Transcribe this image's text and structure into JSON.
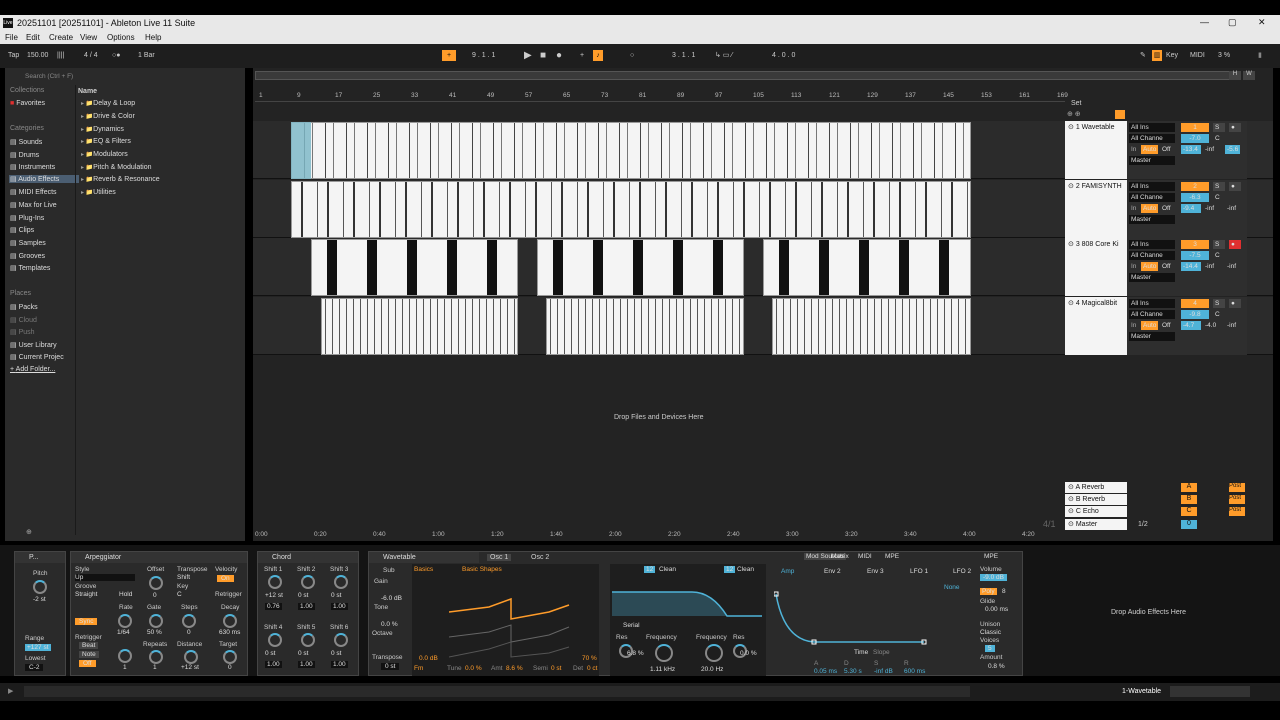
{
  "window": {
    "title": "20251101  [20251101] - Ableton Live 11 Suite",
    "controls": [
      "—",
      "▢",
      "✕"
    ]
  },
  "menu": [
    "File",
    "Edit",
    "Create",
    "View",
    "Options",
    "Help"
  ],
  "transport": {
    "tap": "Tap",
    "tempo": "150.00",
    "signature": "4 / 4",
    "quantize": "1 Bar",
    "position": "9 .  1 .  1",
    "loop_start": "3 .  1 .  1",
    "loop_length": "4 .  0 .  0",
    "key": "Key",
    "midi": "MIDI",
    "cpu": "3 %"
  },
  "browser": {
    "search_placeholder": "Search (Ctrl + F)",
    "collections_label": "Collections",
    "favorites": "Favorites",
    "categories_label": "Categories",
    "categories": [
      "Sounds",
      "Drums",
      "Instruments",
      "Audio Effects",
      "MIDI Effects",
      "Max for Live",
      "Plug-Ins",
      "Clips",
      "Samples",
      "Grooves",
      "Templates"
    ],
    "places_label": "Places",
    "places": [
      "Packs",
      "Cloud",
      "Push",
      "User Library",
      "Current Projec",
      "Add Folder..."
    ],
    "name_header": "Name",
    "folders": [
      "Delay & Loop",
      "Drive & Color",
      "Dynamics",
      "EQ & Filters",
      "Modulators",
      "Pitch & Modulation",
      "Reverb & Resonance",
      "Utilities"
    ]
  },
  "arrangement": {
    "bar_ticks": [
      "1",
      "9",
      "17",
      "25",
      "33",
      "41",
      "49",
      "57",
      "65",
      "73",
      "81",
      "89",
      "97",
      "105",
      "113",
      "121",
      "129",
      "137",
      "145",
      "153",
      "161",
      "169"
    ],
    "time_ticks": [
      "0:00",
      "0:20",
      "0:40",
      "1:00",
      "1:20",
      "1:40",
      "2:00",
      "2:20",
      "2:40",
      "3:00",
      "3:20",
      "3:40",
      "4:00",
      "4:20"
    ],
    "drop_text": "Drop Files and Devices Here",
    "set_label": "Set",
    "page": "4/1",
    "tracks": [
      {
        "name": "1 Wavetable",
        "input": "All Ins",
        "channel": "All Channe",
        "num": "1",
        "vol": "-7.0",
        "pan": "C",
        "meter1": "-13.4",
        "meter2": "-inf",
        "meter3": "-5.6"
      },
      {
        "name": "2 FAMISYNTH",
        "input": "All Ins",
        "channel": "All Channe",
        "num": "2",
        "vol": "-6.3",
        "pan": "C",
        "meter1": "-9.4",
        "meter2": "-inf",
        "meter3": "-inf"
      },
      {
        "name": "3 808 Core Ki",
        "input": "All Ins",
        "channel": "All Channe",
        "num": "3",
        "vol": "-7.5",
        "pan": "C",
        "meter1": "-14.4",
        "meter2": "-inf",
        "meter3": "-inf"
      },
      {
        "name": "4 Magical8bit",
        "input": "All Ins",
        "channel": "All Channe",
        "num": "4",
        "vol": "-9.8",
        "pan": "C",
        "meter1": "-4.7",
        "meter2": "-4.0",
        "meter3": "-inf"
      }
    ],
    "io": {
      "in": "In",
      "auto": "Auto",
      "off": "Off",
      "master": "Master"
    },
    "returns": [
      {
        "name": "A Reverb",
        "letter": "A"
      },
      {
        "name": "B Reverb",
        "letter": "B"
      },
      {
        "name": "C Echo",
        "letter": "C"
      }
    ],
    "master": {
      "name": "Master",
      "ratio": "1/2",
      "vol": "0",
      "post": "Post"
    }
  },
  "devices": {
    "pitch": {
      "title": "P...",
      "label": "Pitch",
      "value": "-2 st",
      "range_label": "Range",
      "range": "+127 st",
      "lowest_label": "Lowest",
      "lowest": "C-2"
    },
    "arp": {
      "title": "Arpeggiator",
      "style_label": "Style",
      "style": "Up",
      "groove_label": "Groove",
      "groove": "Straight",
      "hold": "Hold",
      "offset_label": "Offset",
      "offset": "0",
      "transpose_label": "Transpose",
      "transpose": "Shift",
      "key_label": "Key",
      "key": "C",
      "velocity_label": "Velocity",
      "velocity": "On",
      "sync": "Sync",
      "rate_label": "Rate",
      "rate": "1/64",
      "gate_label": "Gate",
      "gate": "50 %",
      "steps_label": "Steps",
      "steps": "0",
      "decay_label": "Decay",
      "decay": "630 ms",
      "retrig_label": "Retrigger",
      "retrig": "Beat",
      "note": "Note",
      "off": "Off",
      "repeats_label": "Repeats",
      "repeats": "1",
      "distance_label": "Distance",
      "distance": "+12 st",
      "target_label": "Target",
      "target": "0",
      "retrigger2": "Retrigger",
      "one": "1"
    },
    "chord": {
      "title": "Chord",
      "shifts": [
        "Shift 1",
        "Shift 2",
        "Shift 3",
        "Shift 4",
        "Shift 5",
        "Shift 6"
      ],
      "shift_vals": [
        "+12 st",
        "0 st",
        "0 st",
        "0 st",
        "0 st",
        "0 st"
      ],
      "vel_vals": [
        "0.76",
        "1.00",
        "1.00",
        "1.00",
        "1.00",
        "1.00"
      ]
    },
    "wavetable": {
      "title": "Wavetable",
      "osc1": "Osc 1",
      "osc2": "Osc 2",
      "sub": "Sub",
      "gain_label": "Gain",
      "gain": "-6.0 dB",
      "tone_label": "Tone",
      "tone": "0.0 %",
      "octave_label": "Octave",
      "transpose_label": "Transpose",
      "transpose": "0 st",
      "category": "Basics",
      "table": "Basic Shapes",
      "osc_gain": "0.0 dB",
      "fm": "Fm",
      "tune": "Tune",
      "tune_val": "0.0 %",
      "amt": "Amt",
      "amt_val": "8.6 %",
      "semi": "Semi",
      "semi_val": "0 st",
      "det": "Det",
      "det_val": "0 ct",
      "pos_val": "70 %",
      "filt1": "12",
      "clean1": "Clean",
      "filt2": "12",
      "clean2": "Clean",
      "serial": "Serial",
      "res1_label": "Res",
      "res1": "6.8 %",
      "freq1_label": "Frequency",
      "freq1": "1.11 kHz",
      "freq2_label": "Frequency",
      "freq2": "20.0 Hz",
      "res2_label": "Res",
      "res2": "0.0 %",
      "mod_tabs": [
        "Mod Sources",
        "Matrix",
        "MIDI",
        "MPE"
      ],
      "env_tabs": [
        "Amp",
        "Env 2",
        "Env 3",
        "LFO 1",
        "LFO 2"
      ],
      "none": "None",
      "time": "Time",
      "slope": "Slope",
      "adsr_labels": [
        "A",
        "D",
        "S",
        "R"
      ],
      "adsr_vals": [
        "0.05 ms",
        "5.30 s",
        "-inf dB",
        "600 ms"
      ],
      "mpe": "MPE",
      "volume_label": "Volume",
      "volume": "-9.0 dB",
      "poly": "Poly",
      "poly_val": "8",
      "glide_label": "Glide",
      "glide": "0.00 ms",
      "unison_label": "Unison",
      "unison": "Classic",
      "voices_label": "Voices",
      "voices": "5",
      "amount_label": "Amount",
      "amount": "0.8 %"
    },
    "drop_audio": "Drop Audio Effects Here"
  },
  "status": {
    "selected": "1-Wavetable"
  },
  "colors": {
    "accent": "#ff9c2a",
    "blue": "#4fb3d8",
    "clip": "#f4f4f4",
    "red": "#e03030"
  }
}
